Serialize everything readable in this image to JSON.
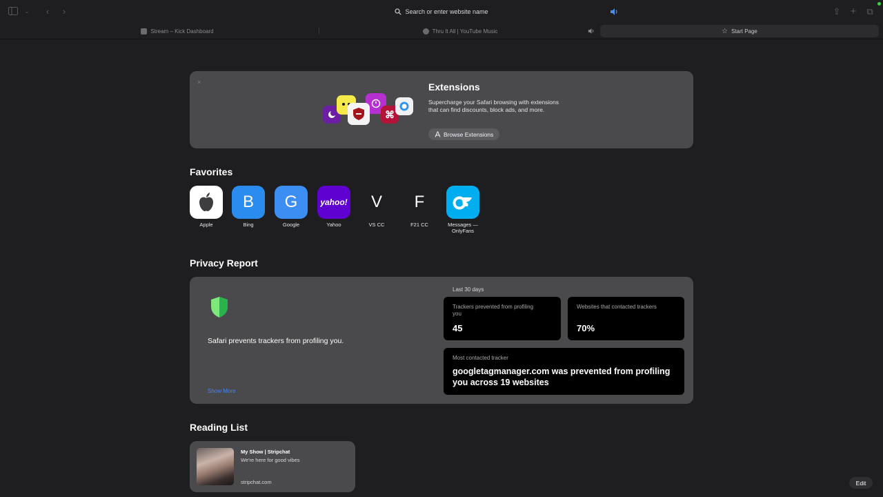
{
  "address_bar": {
    "placeholder": "Search or enter website name"
  },
  "tabs": [
    {
      "label": "Stream – Kick Dashboard"
    },
    {
      "label": "Thru It All | YouTube Music"
    },
    {
      "label": "Start Page"
    }
  ],
  "extensions": {
    "title": "Extensions",
    "description": "Supercharge your Safari browsing with extensions that can find discounts, block ads, and more.",
    "button": "Browse Extensions",
    "close": "×"
  },
  "favorites": {
    "title": "Favorites",
    "items": [
      {
        "label": "Apple",
        "glyph": "",
        "color": "#ffffff"
      },
      {
        "label": "Bing",
        "glyph": "B",
        "color": "#2b8cf0"
      },
      {
        "label": "Google",
        "glyph": "G",
        "color": "#3d8ef2"
      },
      {
        "label": "Yahoo",
        "glyph": "yahoo!",
        "color": "#5f01d1"
      },
      {
        "label": "VS CC",
        "glyph": "V",
        "color": "#1e1e20"
      },
      {
        "label": "F21 CC",
        "glyph": "F",
        "color": "#1e1e20"
      },
      {
        "label": "Messages — OnlyFans",
        "glyph": "",
        "color": "#00aeef"
      }
    ]
  },
  "privacy": {
    "title": "Privacy Report",
    "message": "Safari prevents trackers from profiling you.",
    "show_more": "Show More",
    "period": "Last 30 days",
    "trackers_label": "Trackers prevented from profiling you",
    "trackers_value": "45",
    "websites_label": "Websites that contacted trackers",
    "websites_value": "70%",
    "most_contacted_label": "Most contacted tracker",
    "most_contacted_text": "googletagmanager.com was prevented from profiling you across 19 websites"
  },
  "reading_list": {
    "title": "Reading List",
    "items": [
      {
        "title": "My Show | Stripchat",
        "subtitle": "We're here for good vibes",
        "url": "stripchat.com"
      }
    ]
  },
  "edit_button": "Edit"
}
